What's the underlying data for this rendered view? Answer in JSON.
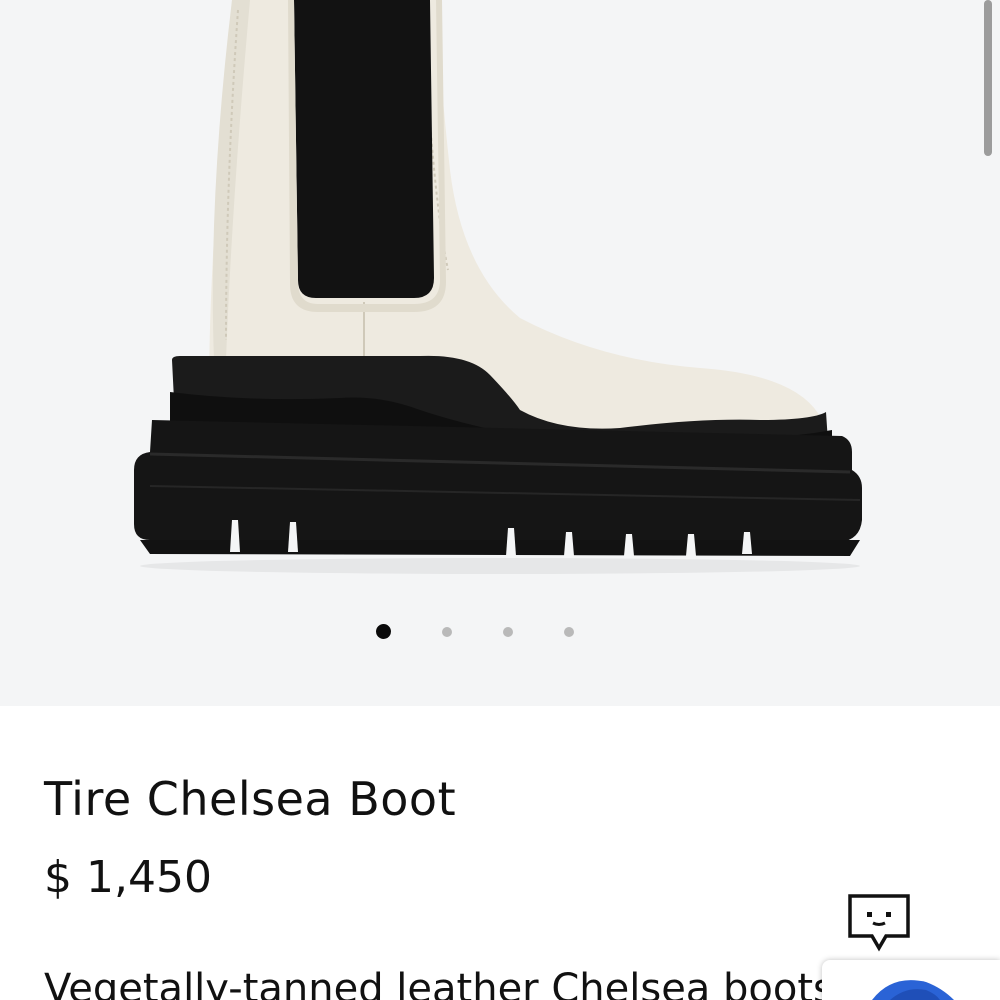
{
  "product": {
    "title": "Tire Chelsea Boot",
    "price": "$ 1,450",
    "description": "Vegetally-tanned leather Chelsea boots"
  },
  "gallery": {
    "image_count": 4,
    "active_index": 0,
    "background_color": "#f4f5f6",
    "boot_upper_color": "#eeeae0",
    "boot_sole_color": "#151515"
  },
  "chat": {
    "icon": "chat-bubble-icon"
  },
  "badge": {
    "icon": "logo-badge-icon",
    "color": "#2a63d6"
  }
}
